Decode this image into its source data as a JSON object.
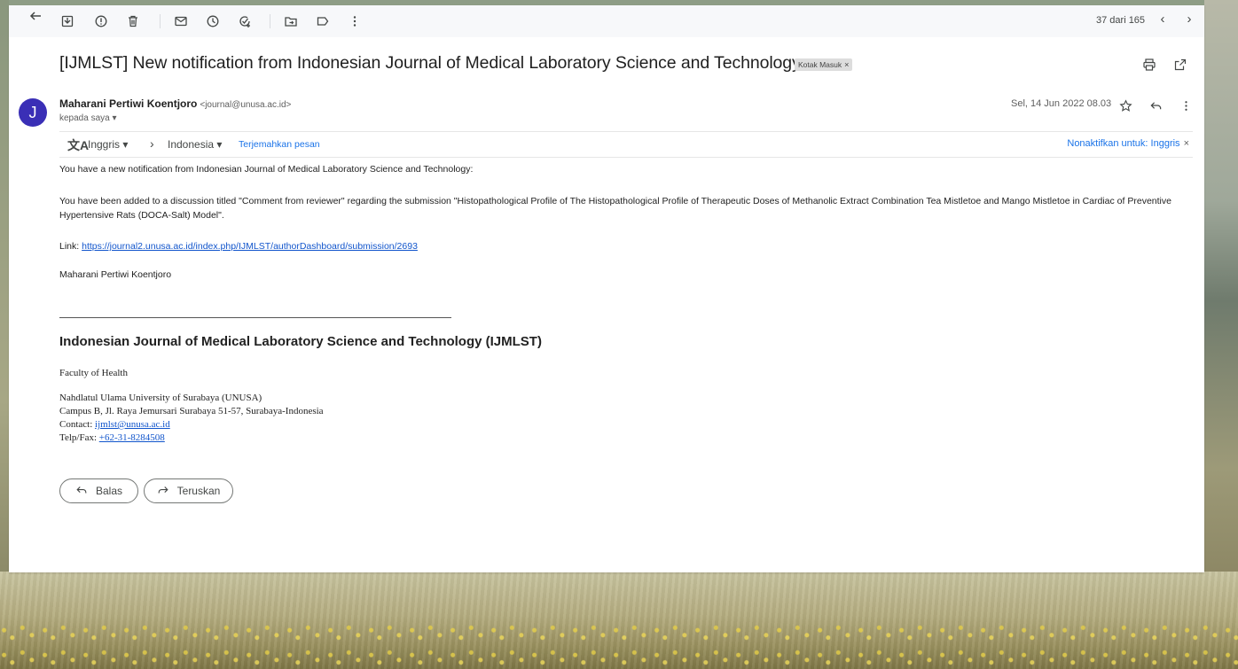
{
  "toolbar": {
    "counter": "37 dari 165",
    "prev": "‹",
    "next": "›"
  },
  "email": {
    "subject": "[IJMLST] New notification from Indonesian Journal of Medical Laboratory Science and Technology",
    "label": "Kotak Masuk",
    "label_close": "×",
    "sender_initial": "J",
    "sender_name": "Maharani Pertiwi Koentjoro",
    "sender_email": "<journal@unusa.ac.id>",
    "to": "kepada saya ▾",
    "date": "Sel, 14 Jun 2022 08.03"
  },
  "translate": {
    "from": "Inggris ▾",
    "to": "Indonesia ▾",
    "action": "Terjemahkan pesan",
    "disable": "Nonaktifkan untuk: Inggris",
    "disable_close": "×"
  },
  "body": {
    "intro": "You have a new notification from Indonesian Journal of Medical Laboratory Science and Technology:",
    "discussion": "You have been added to a discussion titled \"Comment from reviewer\" regarding the submission \"Histopathological Profile of The Histopathological Profile of Therapeutic Doses of Methanolic Extract Combination Tea Mistletoe and Mango Mistletoe in Cardiac of Preventive Hypertensive Rats (DOCA-Salt) Model\".",
    "link_label": "Link:",
    "link_url": "https://journal2.unusa.ac.id/index.php/IJMLST/authorDashboard/submission/2693",
    "signature": "Maharani Pertiwi Koentjoro"
  },
  "footer": {
    "journal_title": "Indonesian Journal of Medical Laboratory Science and Technology (IJMLST)",
    "faculty": "Faculty of Health",
    "university": "Nahdlatul Ulama University of Surabaya (UNUSA)",
    "address": "Campus B, Jl. Raya Jemursari Surabaya 51-57, Surabaya-Indonesia",
    "contact_label": "Contact:",
    "contact_email": "ijmlst@unusa.ac.id",
    "phone_label": "Telp/Fax:",
    "phone": "+62-31-8284508"
  },
  "actions": {
    "reply": "Balas",
    "forward": "Teruskan"
  }
}
